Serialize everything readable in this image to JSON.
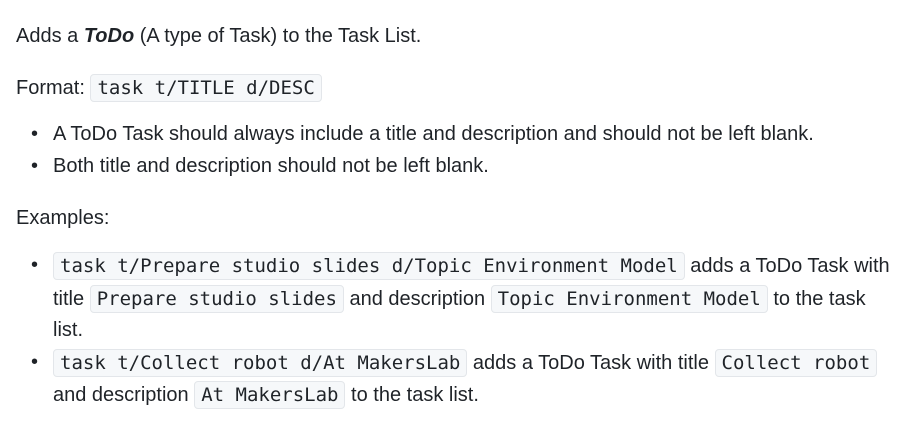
{
  "intro": {
    "prefix": "Adds a ",
    "emphasis": "ToDo",
    "suffix": " (A type of Task) to the Task List."
  },
  "format": {
    "label": "Format: ",
    "code": "task t/TITLE d/DESC"
  },
  "notes": [
    "A ToDo Task should always include a title and description and should not be left blank.",
    "Both title and description should not be left blank."
  ],
  "examples_heading": "Examples:",
  "examples": [
    {
      "command": "task t/Prepare studio slides d/Topic Environment Model",
      "text_1": " adds a ToDo Task with title ",
      "title": "Prepare studio slides",
      "text_2": " and description ",
      "description": "Topic Environment Model",
      "text_3": " to the task list."
    },
    {
      "command": "task t/Collect robot d/At MakersLab",
      "text_1": " adds a ToDo Task with title ",
      "title": "Collect robot",
      "text_2": " and description ",
      "description": "At MakersLab",
      "text_3": " to the task list."
    }
  ]
}
